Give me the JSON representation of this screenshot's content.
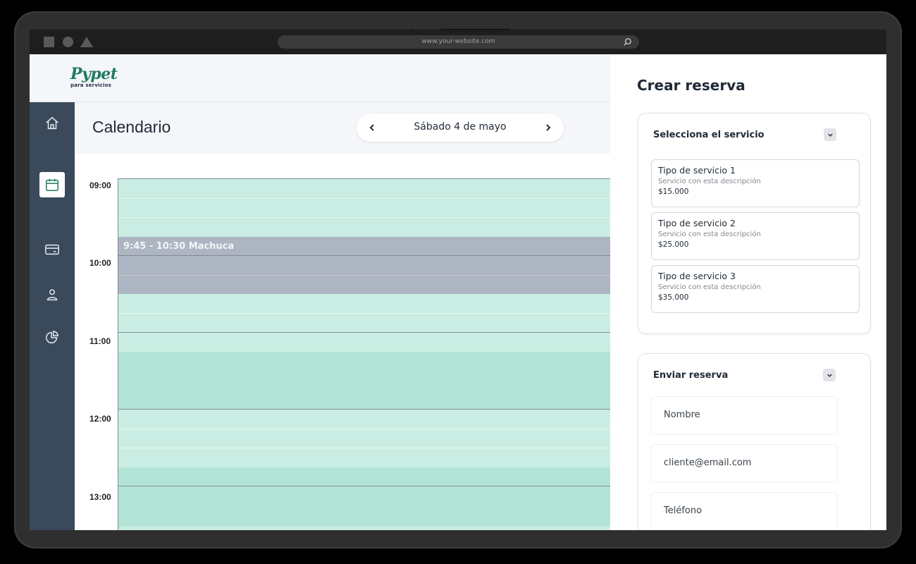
{
  "browser": {
    "url": "www.your-website.com"
  },
  "brand": {
    "name": "Pypet",
    "tagline": "para servicios"
  },
  "sidebar": {
    "items": [
      {
        "icon": "home-icon",
        "active": false
      },
      {
        "icon": "calendar-icon",
        "active": true
      },
      {
        "icon": "card-icon",
        "active": false
      },
      {
        "icon": "user-icon",
        "active": false
      },
      {
        "icon": "pie-chart-icon",
        "active": false
      }
    ]
  },
  "calendar": {
    "title": "Calendario",
    "date": "Sábado 4 de mayo",
    "prev_symbol": "<",
    "next_symbol": ">",
    "hours": [
      "09:00",
      "10:00",
      "11:00",
      "12:00",
      "13:00"
    ],
    "booking": "9:45 - 10:30 Machuca"
  },
  "panel": {
    "title": "Crear reserva",
    "service_section": {
      "title": "Selecciona el servicio",
      "services": [
        {
          "name": "Tipo de servicio 1",
          "description": "Servicio con esta descripción",
          "price": "$15.000"
        },
        {
          "name": "Tipo de servicio 2",
          "description": "Servicio con esta descripción",
          "price": "$25.000"
        },
        {
          "name": "Tipo de servicio 3",
          "description": "Servicio con esta descripción",
          "price": "$35.000"
        }
      ]
    },
    "booking_section": {
      "title": "Enviar reserva",
      "fields": {
        "name": "Nombre",
        "email": "cliente@email.com",
        "phone": "Teléfono"
      }
    }
  },
  "colors": {
    "brand_green": "#1f7a5e",
    "sidebar_bg": "#3b4a5a",
    "slot_light": "#c9ede2",
    "slot_mid": "#b3e5d6",
    "booking_gray": "#adb5c2"
  }
}
